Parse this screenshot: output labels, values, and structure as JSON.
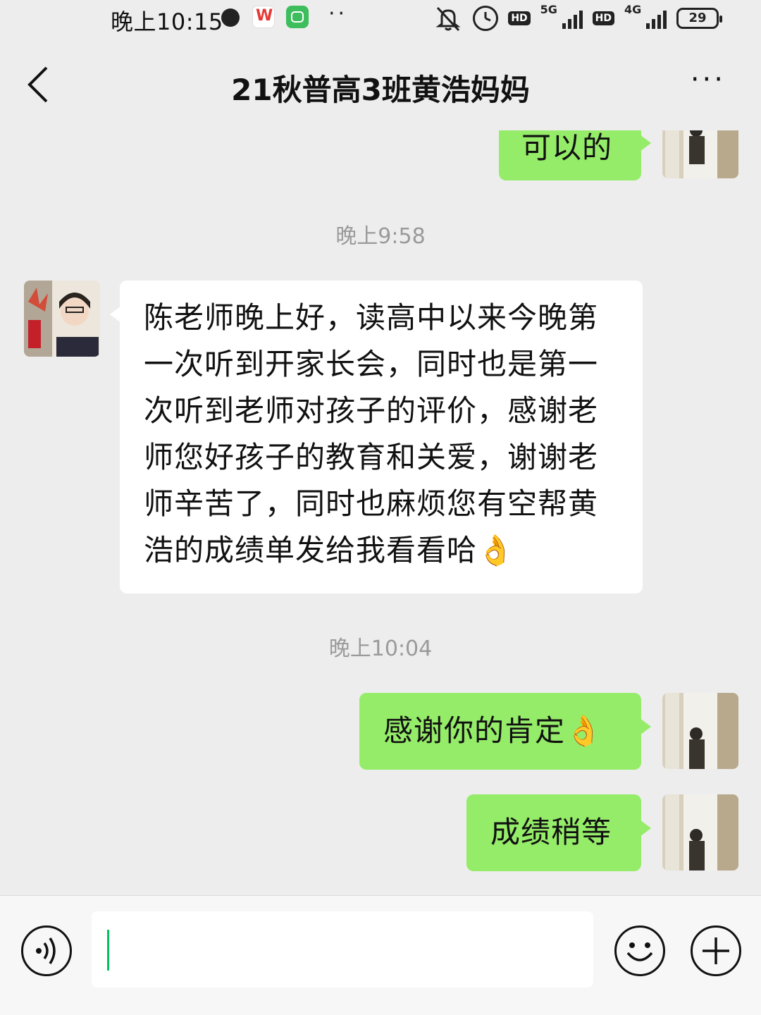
{
  "status_bar": {
    "time": "晚上10:15",
    "icons": [
      "clock-dot-icon",
      "wps-icon",
      "app-icon",
      "more-dots-icon",
      "mute-icon",
      "alarm-icon",
      "hd-icon",
      "signal-5g-icon",
      "hd-icon",
      "signal-4g-icon",
      "battery-icon"
    ],
    "hd_label": "HD",
    "net1": "5G",
    "net2": "4G",
    "battery": "29"
  },
  "header": {
    "title": "21秋普高3班黄浩妈妈",
    "back_icon": "chevron-left-icon",
    "menu": "···"
  },
  "messages": [
    {
      "side": "out",
      "text": "可以的"
    },
    {
      "timestamp": "晚上9:58"
    },
    {
      "side": "in",
      "lines": [
        "陈老师晚上好，读高中以来今晚第",
        "一次听到开家长会，同时也是第一",
        "次听到老师对孩子的评价，感谢老",
        "师您好孩子的教育和关爱，谢谢老",
        "师辛苦了，同时也麻烦您有空帮黄",
        "浩的成绩单发给我看看哈👌"
      ]
    },
    {
      "timestamp": "晚上10:04"
    },
    {
      "side": "out",
      "text": "感谢你的肯定👌"
    },
    {
      "side": "out",
      "text": "成绩稍等"
    }
  ],
  "input_bar": {
    "voice_icon": "voice-icon",
    "text_value": "",
    "emoji_icon": "emoji-icon",
    "plus_icon": "plus-icon"
  },
  "colors": {
    "background": "#ededed",
    "outgoing_bubble": "#95ec69",
    "incoming_bubble": "#ffffff",
    "caret": "#07c160"
  }
}
